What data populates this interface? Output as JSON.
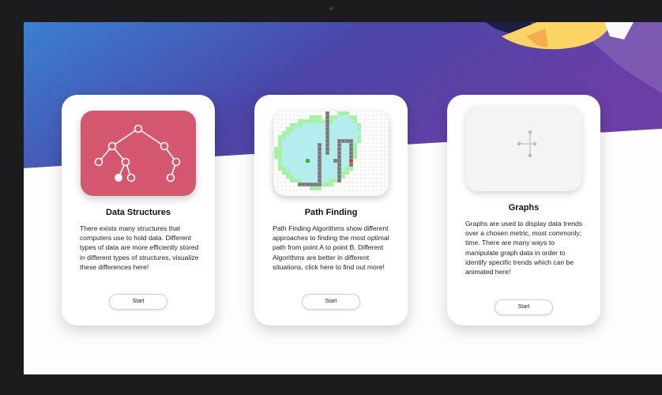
{
  "cards": [
    {
      "title": "Data Structures",
      "description": "There exists many structures that computers use to hold data. Different types of data are more efficiently stored in different types of structures, visualize these differences here!",
      "button_label": "Start",
      "thumbnail_icon": "binary-tree-icon",
      "thumbnail_color": "#d4566f"
    },
    {
      "title": "Path Finding",
      "description": "Path Finding Algorithms show different approaches to finding the most optimal path from point A to point B. Different Algorithms are better in different situations, click here to find out more!",
      "button_label": "Start",
      "thumbnail_icon": "grid-pathfinding-icon"
    },
    {
      "title": "Graphs",
      "description": "Graphs are used to display data trends over a chosen metric, most commonly; time. There are many ways to manipulate graph data in order to identify specific trends which can be animated here!",
      "button_label": "Start",
      "thumbnail_icon": "graph-axis-icon"
    }
  ],
  "colors": {
    "background_gradient_start": "#3a80d2",
    "background_gradient_end": "#6a3ea8",
    "card_background": "#ffffff",
    "grid_wall": "#777777",
    "grid_visited": "#aef0f0",
    "grid_frontier": "#9ef59e",
    "start_node": "#22b822",
    "end_node": "#d23a1a"
  }
}
